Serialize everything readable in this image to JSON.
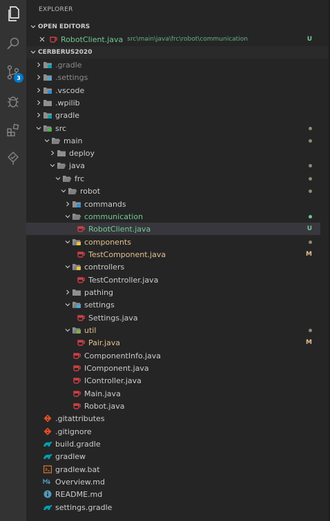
{
  "explorer": {
    "title": "EXPLORER"
  },
  "activity_bar": {
    "scm_badge": "3"
  },
  "open_editors": {
    "header": "OPEN EDITORS",
    "items": [
      {
        "label": "RobotClient.java",
        "path": "src\\main\\java\\frc\\robot\\communication",
        "status": "U"
      }
    ]
  },
  "workspace": {
    "header": "CERBERUS2020",
    "tree": [
      {
        "label": ".gradle",
        "status": ""
      },
      {
        "label": ".settings",
        "status": ""
      },
      {
        "label": ".vscode",
        "status": ""
      },
      {
        "label": ".wpilib",
        "status": ""
      },
      {
        "label": "gradle",
        "status": ""
      },
      {
        "label": "src",
        "status": ""
      },
      {
        "label": "main",
        "status": ""
      },
      {
        "label": "deploy",
        "status": ""
      },
      {
        "label": "java",
        "status": ""
      },
      {
        "label": "frc",
        "status": ""
      },
      {
        "label": "robot",
        "status": ""
      },
      {
        "label": "commands",
        "status": ""
      },
      {
        "label": "communication",
        "status": ""
      },
      {
        "label": "RobotClient.java",
        "status": "U"
      },
      {
        "label": "components",
        "status": ""
      },
      {
        "label": "TestComponent.java",
        "status": "M"
      },
      {
        "label": "controllers",
        "status": ""
      },
      {
        "label": "TestController.java",
        "status": ""
      },
      {
        "label": "pathing",
        "status": ""
      },
      {
        "label": "settings",
        "status": ""
      },
      {
        "label": "Settings.java",
        "status": ""
      },
      {
        "label": "util",
        "status": ""
      },
      {
        "label": "Pair.java",
        "status": "M"
      },
      {
        "label": "ComponentInfo.java",
        "status": ""
      },
      {
        "label": "IComponent.java",
        "status": ""
      },
      {
        "label": "IController.java",
        "status": ""
      },
      {
        "label": "Main.java",
        "status": ""
      },
      {
        "label": "Robot.java",
        "status": ""
      },
      {
        "label": ".gitattributes",
        "status": ""
      },
      {
        "label": ".gitignore",
        "status": ""
      },
      {
        "label": "build.gradle",
        "status": ""
      },
      {
        "label": "gradlew",
        "status": ""
      },
      {
        "label": "gradlew.bat",
        "status": ""
      },
      {
        "label": "Overview.md",
        "status": ""
      },
      {
        "label": "README.md",
        "status": ""
      },
      {
        "label": "settings.gradle",
        "status": ""
      }
    ]
  },
  "colors": {
    "untracked": "#73c991",
    "modified": "#e2c08d",
    "java_icon": "#cc3e44",
    "folder": "#c09553",
    "accent": "#007acc"
  }
}
